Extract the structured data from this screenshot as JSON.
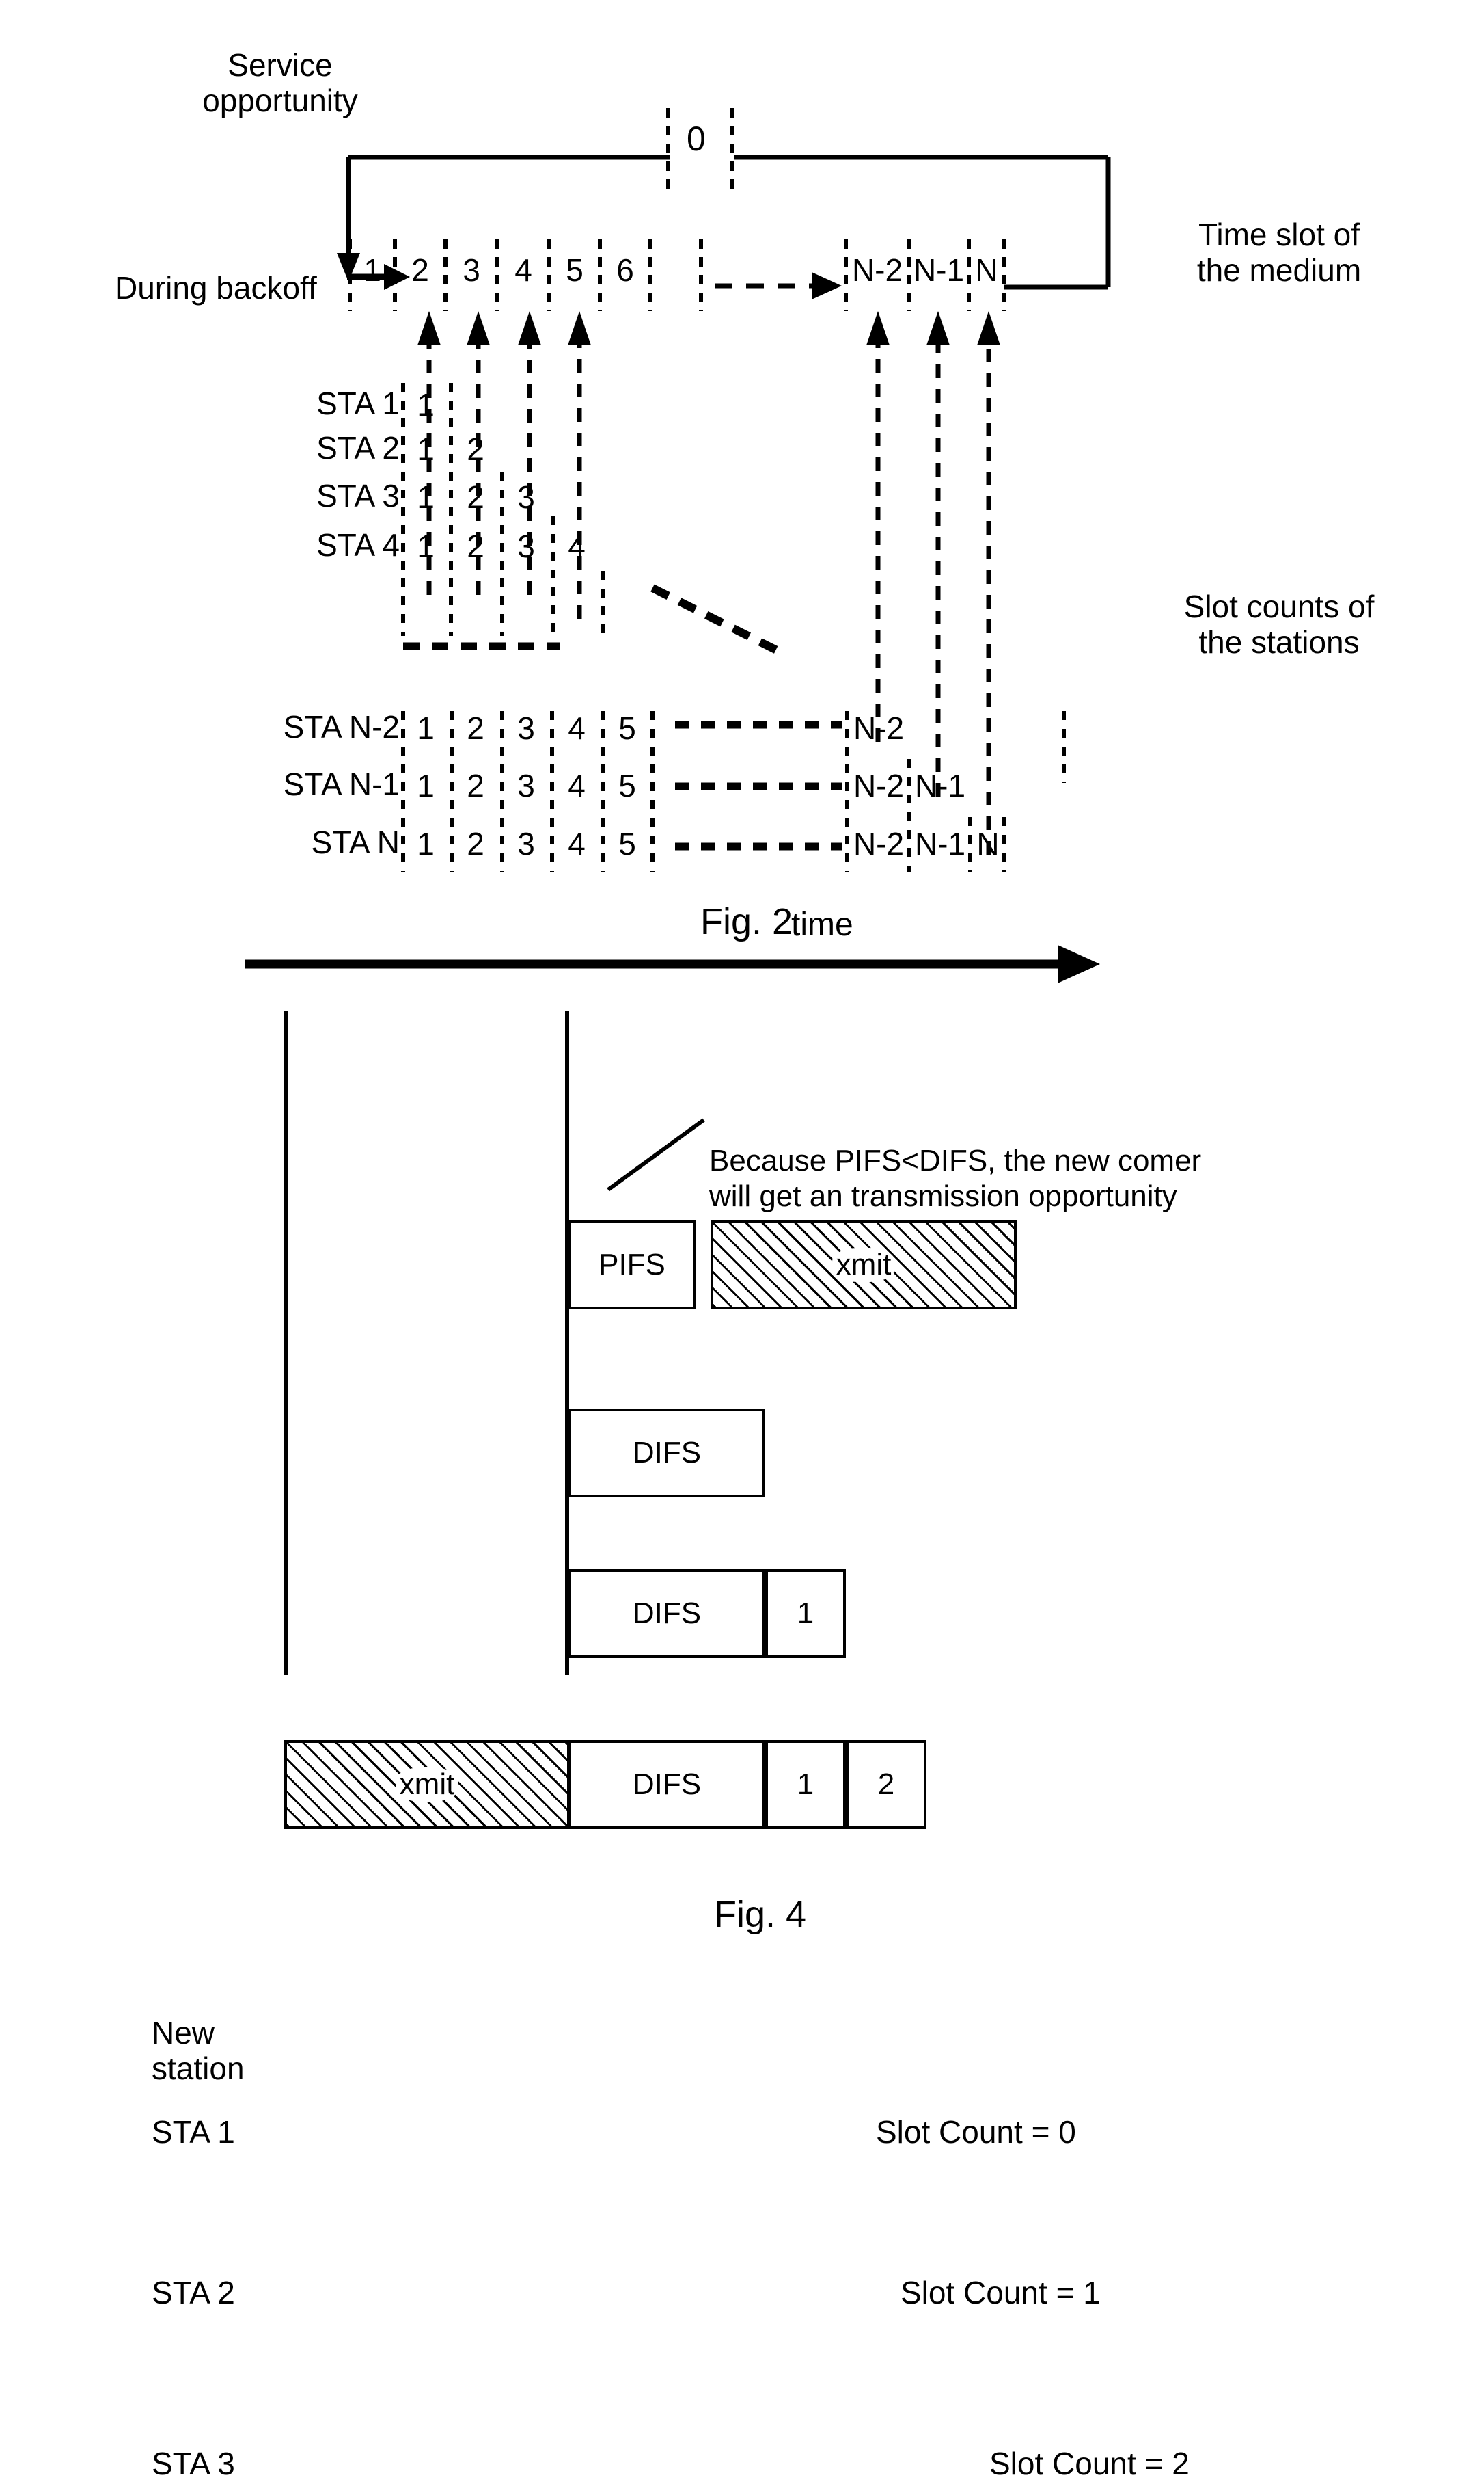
{
  "figure2": {
    "caption": "Fig. 2",
    "labels": {
      "service_opportunity": "Service\nopportunity",
      "during_backoff": "During backoff",
      "time_slot_of_medium": "Time slot of\nthe medium",
      "slot_counts_of_stations": "Slot counts of\nthe stations",
      "zero_marker": "0"
    },
    "medium_slots": [
      "1",
      "2",
      "3",
      "4",
      "5",
      "6",
      "N-2",
      "N-1",
      "N"
    ],
    "station_rows": [
      {
        "name": "STA 1",
        "counts": [
          "1"
        ]
      },
      {
        "name": "STA 2",
        "counts": [
          "1",
          "2"
        ]
      },
      {
        "name": "STA 3",
        "counts": [
          "1",
          "2",
          "3"
        ]
      },
      {
        "name": "STA 4",
        "counts": [
          "1",
          "2",
          "3",
          "4"
        ]
      },
      {
        "name": "STA N-2",
        "counts": [
          "1",
          "2",
          "3",
          "4",
          "5",
          "N-2"
        ]
      },
      {
        "name": "STA N-1",
        "counts": [
          "1",
          "2",
          "3",
          "4",
          "5",
          "N-2",
          "N-1"
        ]
      },
      {
        "name": "STA N",
        "counts": [
          "1",
          "2",
          "3",
          "4",
          "5",
          "N-2",
          "N-1",
          "N"
        ]
      }
    ]
  },
  "figure4": {
    "caption": "Fig. 4",
    "time_axis_label": "time",
    "annotation": "Because PIFS<DIFS, the new comer\nwill get an transmission opportunity",
    "rows": [
      {
        "label": "New\nstation",
        "pre_medium": null,
        "blocks": [
          {
            "text": "PIFS",
            "kind": "plain"
          },
          {
            "text": "xmit",
            "kind": "hatched"
          }
        ],
        "slot_count": null
      },
      {
        "label": "STA 1",
        "pre_medium": null,
        "blocks": [
          {
            "text": "DIFS",
            "kind": "plain"
          }
        ],
        "slot_count": "Slot Count = 0"
      },
      {
        "label": "STA 2",
        "pre_medium": null,
        "blocks": [
          {
            "text": "DIFS",
            "kind": "plain"
          },
          {
            "text": "1",
            "kind": "plain"
          }
        ],
        "slot_count": "Slot Count = 1"
      },
      {
        "label": "STA 3",
        "pre_medium": {
          "text": "xmit",
          "kind": "hatched"
        },
        "blocks": [
          {
            "text": "DIFS",
            "kind": "plain"
          },
          {
            "text": "1",
            "kind": "plain"
          },
          {
            "text": "2",
            "kind": "plain"
          }
        ],
        "slot_count": "Slot Count = 2"
      }
    ]
  },
  "colors": {
    "ink": "#000000",
    "paper": "#ffffff"
  }
}
